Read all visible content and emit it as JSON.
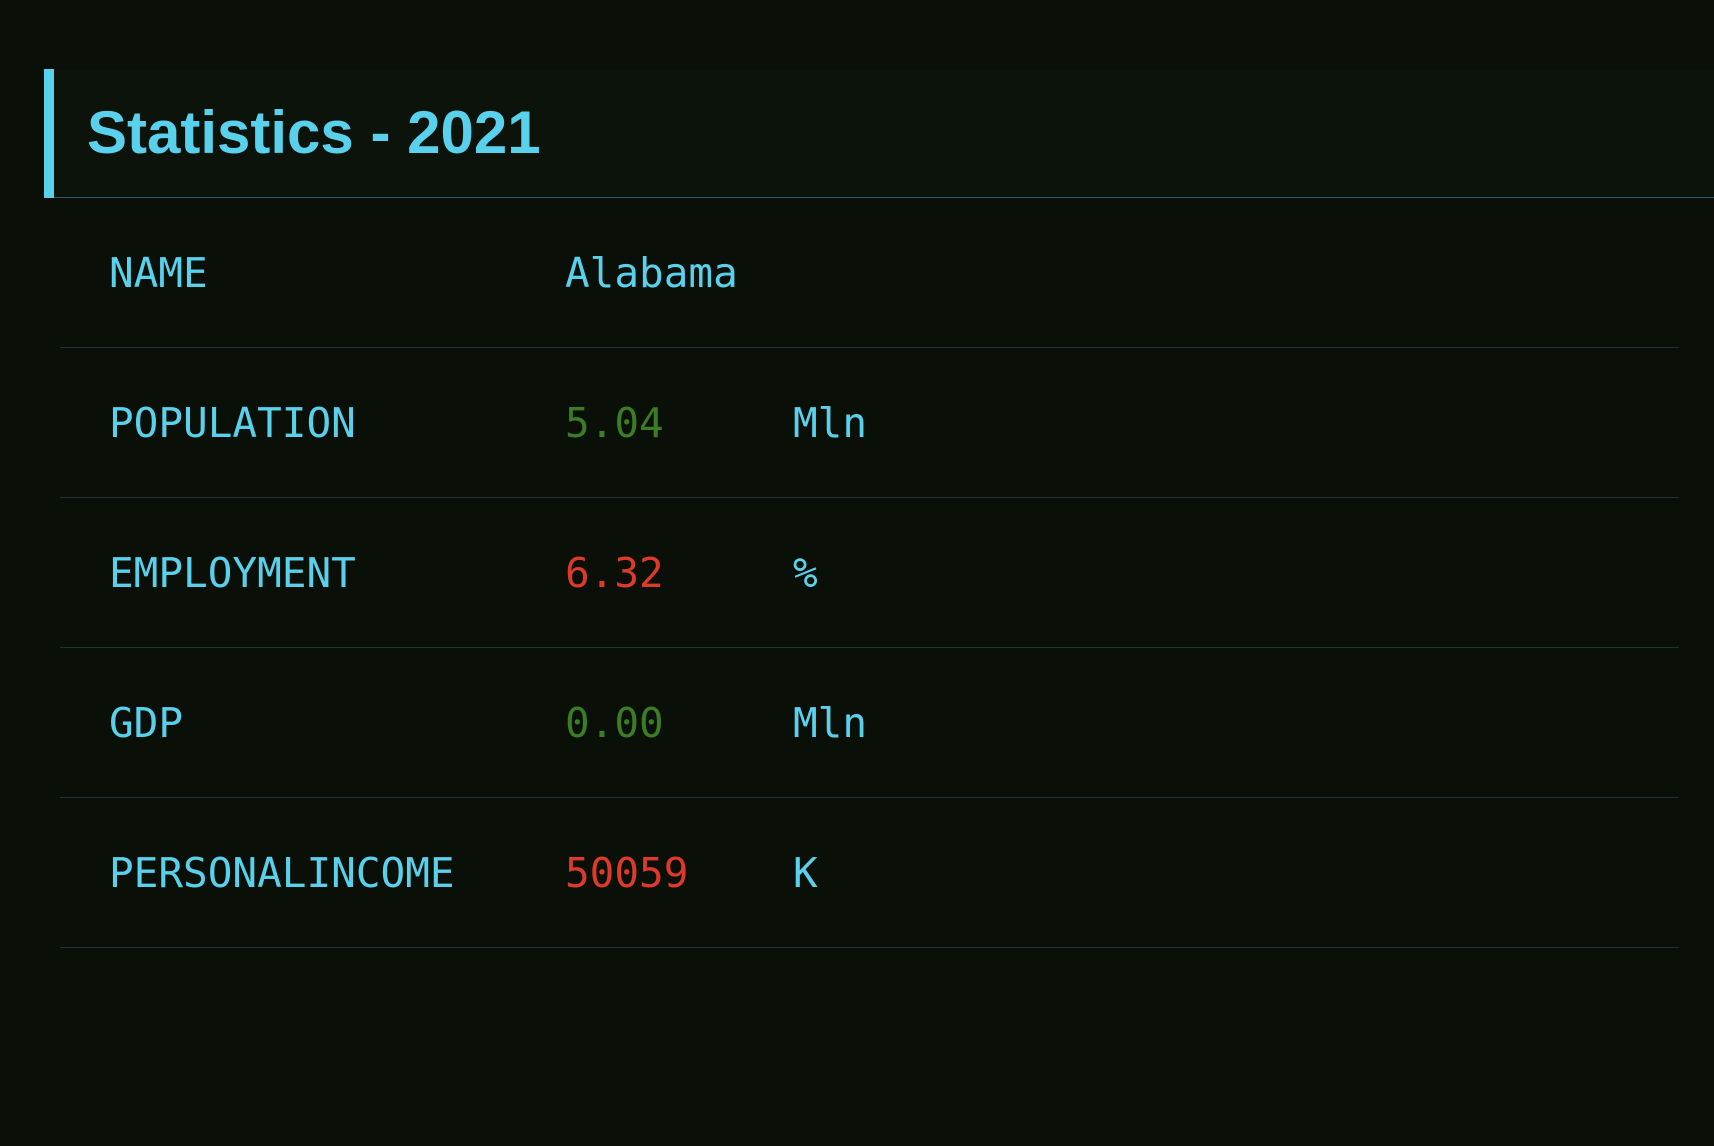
{
  "title": "Statistics - 2021",
  "colors": {
    "accent": "#5ad1ec",
    "positive": "#3b7d23",
    "negative": "#dd3a2a",
    "background": "#0a1008"
  },
  "rows": [
    {
      "label": "NAME",
      "value": "Alabama",
      "unit": "",
      "tone": "neutral"
    },
    {
      "label": "POPULATION",
      "value": "5.04",
      "unit": "Mln",
      "tone": "positive"
    },
    {
      "label": "EMPLOYMENT",
      "value": "6.32",
      "unit": "%",
      "tone": "negative"
    },
    {
      "label": "GDP",
      "value": "0.00",
      "unit": "Mln",
      "tone": "positive"
    },
    {
      "label": "PERSONALINCOME",
      "value": "50059",
      "unit": "K",
      "tone": "negative"
    }
  ]
}
